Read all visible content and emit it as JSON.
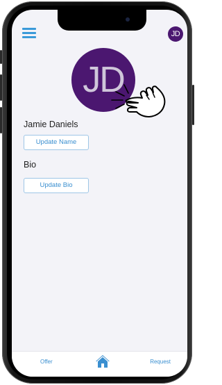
{
  "header": {
    "menu_icon": "hamburger-menu-icon",
    "avatar_initials": "JD"
  },
  "profile": {
    "avatar_initials": "JD",
    "name": "Jamie Daniels",
    "update_name_label": "Update Name",
    "bio_label": "Bio",
    "update_bio_label": "Update Bio",
    "tap_gesture_icon": "tap-hand-icon"
  },
  "tabbar": {
    "offer_label": "Offer",
    "home_icon": "home-icon",
    "request_label": "Request"
  },
  "colors": {
    "accent": "#3a8fd0",
    "avatar": "#4b1770",
    "screen_bg": "#f3f3f8"
  }
}
